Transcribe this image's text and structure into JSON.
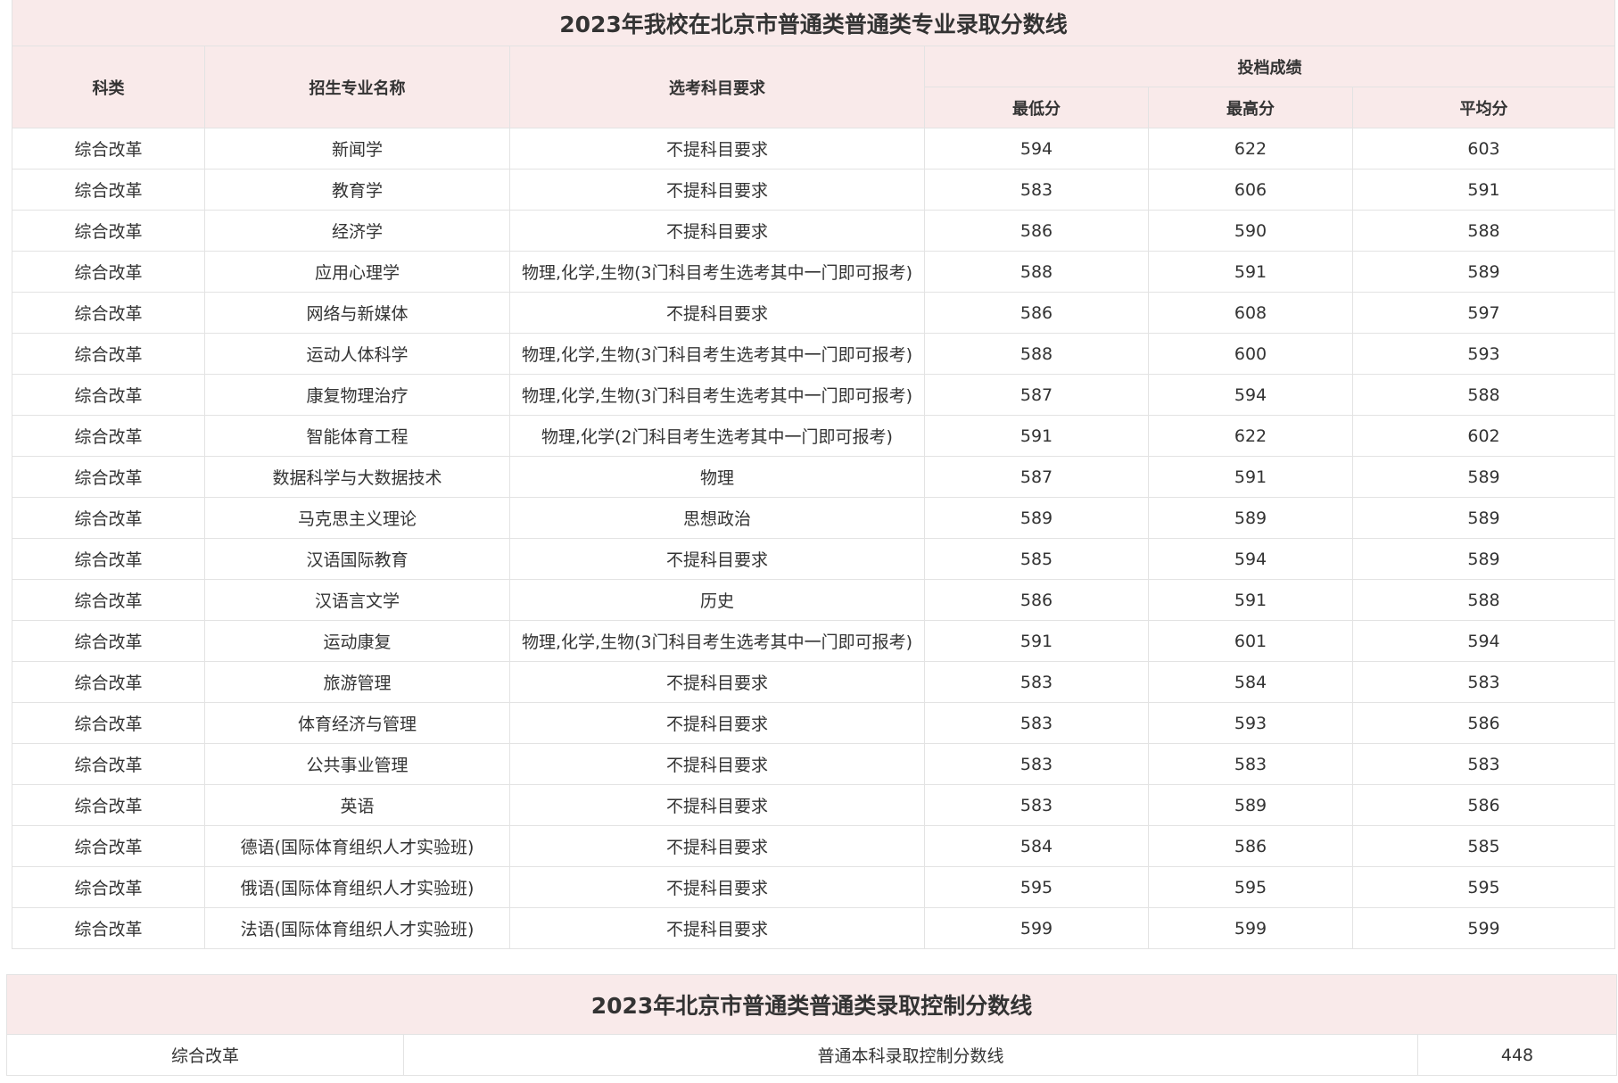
{
  "main_table": {
    "title": "2023年我校在北京市普通类普通类专业录取分数线",
    "headers": {
      "category": "科类",
      "major": "招生专业名称",
      "subjects": "选考科目要求",
      "score_group": "投档成绩",
      "min": "最低分",
      "max": "最高分",
      "avg": "平均分"
    },
    "rows": [
      {
        "category": "综合改革",
        "major": "新闻学",
        "subjects": "不提科目要求",
        "min": "594",
        "max": "622",
        "avg": "603"
      },
      {
        "category": "综合改革",
        "major": "教育学",
        "subjects": "不提科目要求",
        "min": "583",
        "max": "606",
        "avg": "591"
      },
      {
        "category": "综合改革",
        "major": "经济学",
        "subjects": "不提科目要求",
        "min": "586",
        "max": "590",
        "avg": "588"
      },
      {
        "category": "综合改革",
        "major": "应用心理学",
        "subjects": "物理,化学,生物(3门科目考生选考其中一门即可报考)",
        "min": "588",
        "max": "591",
        "avg": "589"
      },
      {
        "category": "综合改革",
        "major": "网络与新媒体",
        "subjects": "不提科目要求",
        "min": "586",
        "max": "608",
        "avg": "597"
      },
      {
        "category": "综合改革",
        "major": "运动人体科学",
        "subjects": "物理,化学,生物(3门科目考生选考其中一门即可报考)",
        "min": "588",
        "max": "600",
        "avg": "593"
      },
      {
        "category": "综合改革",
        "major": "康复物理治疗",
        "subjects": "物理,化学,生物(3门科目考生选考其中一门即可报考)",
        "min": "587",
        "max": "594",
        "avg": "588"
      },
      {
        "category": "综合改革",
        "major": "智能体育工程",
        "subjects": "物理,化学(2门科目考生选考其中一门即可报考)",
        "min": "591",
        "max": "622",
        "avg": "602"
      },
      {
        "category": "综合改革",
        "major": "数据科学与大数据技术",
        "subjects": "物理",
        "min": "587",
        "max": "591",
        "avg": "589"
      },
      {
        "category": "综合改革",
        "major": "马克思主义理论",
        "subjects": "思想政治",
        "min": "589",
        "max": "589",
        "avg": "589"
      },
      {
        "category": "综合改革",
        "major": "汉语国际教育",
        "subjects": "不提科目要求",
        "min": "585",
        "max": "594",
        "avg": "589"
      },
      {
        "category": "综合改革",
        "major": "汉语言文学",
        "subjects": "历史",
        "min": "586",
        "max": "591",
        "avg": "588"
      },
      {
        "category": "综合改革",
        "major": "运动康复",
        "subjects": "物理,化学,生物(3门科目考生选考其中一门即可报考)",
        "min": "591",
        "max": "601",
        "avg": "594"
      },
      {
        "category": "综合改革",
        "major": "旅游管理",
        "subjects": "不提科目要求",
        "min": "583",
        "max": "584",
        "avg": "583"
      },
      {
        "category": "综合改革",
        "major": "体育经济与管理",
        "subjects": "不提科目要求",
        "min": "583",
        "max": "593",
        "avg": "586"
      },
      {
        "category": "综合改革",
        "major": "公共事业管理",
        "subjects": "不提科目要求",
        "min": "583",
        "max": "583",
        "avg": "583"
      },
      {
        "category": "综合改革",
        "major": "英语",
        "subjects": "不提科目要求",
        "min": "583",
        "max": "589",
        "avg": "586"
      },
      {
        "category": "综合改革",
        "major": "德语(国际体育组织人才实验班)",
        "subjects": "不提科目要求",
        "min": "584",
        "max": "586",
        "avg": "585"
      },
      {
        "category": "综合改革",
        "major": "俄语(国际体育组织人才实验班)",
        "subjects": "不提科目要求",
        "min": "595",
        "max": "595",
        "avg": "595"
      },
      {
        "category": "综合改革",
        "major": "法语(国际体育组织人才实验班)",
        "subjects": "不提科目要求",
        "min": "599",
        "max": "599",
        "avg": "599"
      }
    ]
  },
  "control_table": {
    "title": "2023年北京市普通类普通类录取控制分数线",
    "row": {
      "category": "综合改革",
      "label": "普通本科录取控制分数线",
      "score": "448"
    }
  },
  "colors": {
    "header_bg": "#f9eaea",
    "border": "#e3e3e3",
    "text": "#333333"
  }
}
